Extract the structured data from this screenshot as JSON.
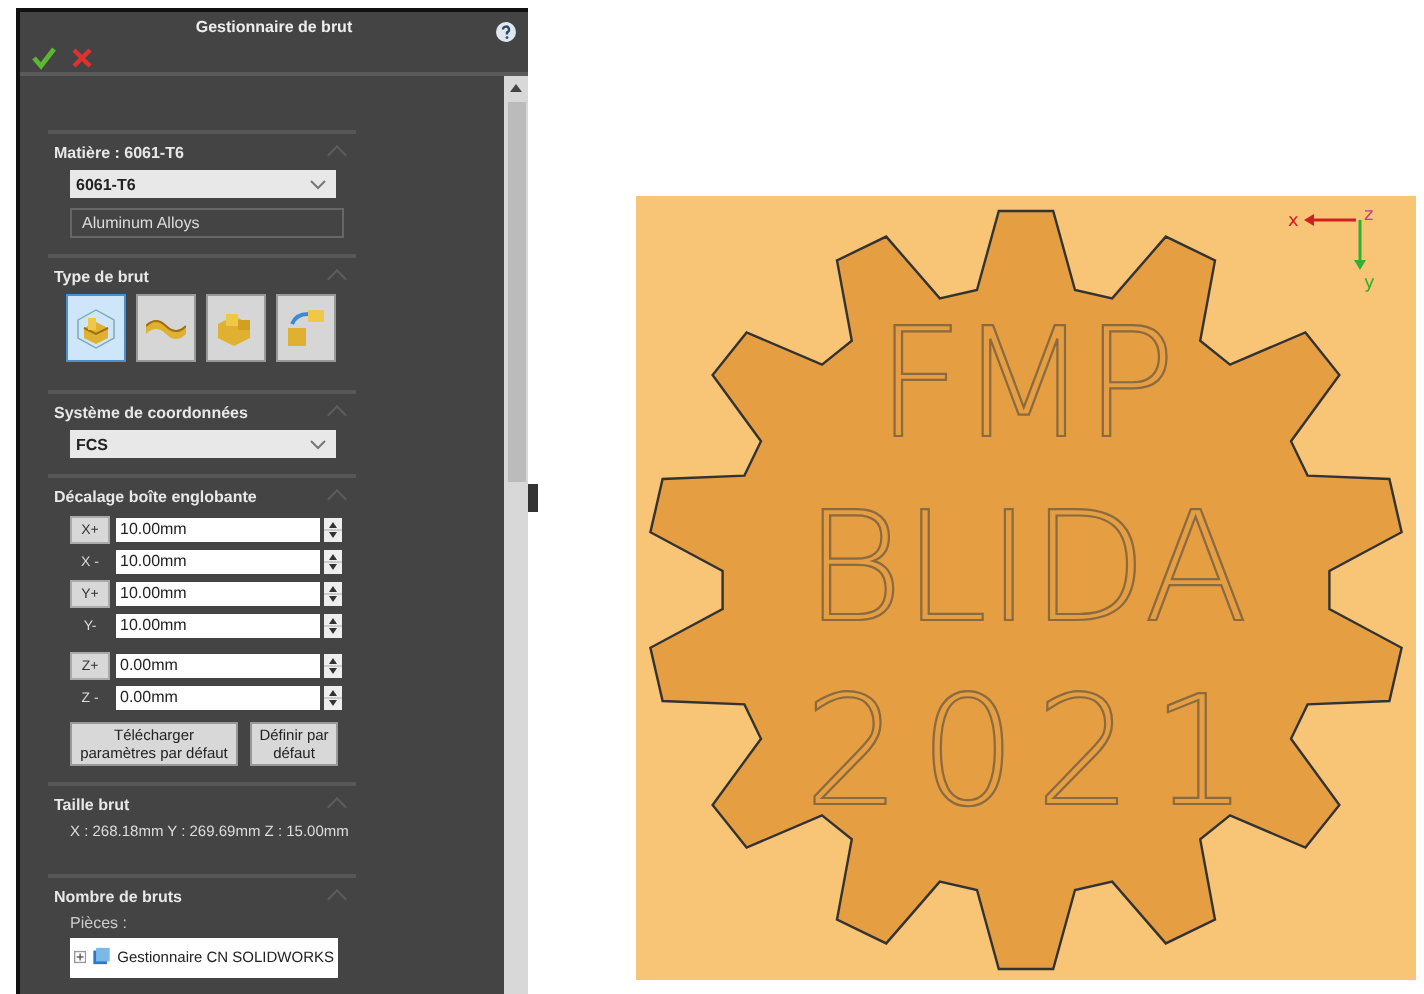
{
  "panel": {
    "title": "Gestionnaire de brut"
  },
  "material": {
    "header": "Matière : 6061-T6",
    "value": "6061-T6",
    "category": "Aluminum Alloys"
  },
  "stock_type": {
    "header": "Type de brut",
    "options": [
      {
        "kind": "box",
        "selected": true
      },
      {
        "kind": "sheet",
        "selected": false
      },
      {
        "kind": "blocks",
        "selected": false
      },
      {
        "kind": "import",
        "selected": false
      }
    ]
  },
  "coordinates": {
    "header": "Système de coordonnées",
    "value": "FCS"
  },
  "offset": {
    "header": "Décalage boîte englobante",
    "rows": [
      {
        "label": "X+",
        "kind": "button",
        "value": "10.00mm"
      },
      {
        "label": "X -",
        "kind": "label",
        "value": "10.00mm"
      },
      {
        "label": "Y+",
        "kind": "button",
        "value": "10.00mm"
      },
      {
        "label": "Y-",
        "kind": "label",
        "value": "10.00mm"
      },
      {
        "label": "Z+",
        "kind": "button",
        "value": "0.00mm"
      },
      {
        "label": "Z -",
        "kind": "label",
        "value": "0.00mm"
      }
    ],
    "buttons": [
      "Télécharger paramètres par défaut",
      "Définir par défaut"
    ]
  },
  "stock_size": {
    "header": "Taille brut",
    "value": "X : 268.18mm Y : 269.69mm Z : 15.00mm"
  },
  "stock_count": {
    "header": "Nombre de bruts",
    "parts_label": "Pièces :",
    "tree": [
      {
        "label": "Gestionnaire CN SOLIDWORKS",
        "expanded": false
      }
    ]
  },
  "viewport": {
    "engraving": [
      "FMP",
      "BLIDA",
      "2021"
    ],
    "axes": {
      "x": "x",
      "y": "y",
      "z": "z"
    }
  }
}
